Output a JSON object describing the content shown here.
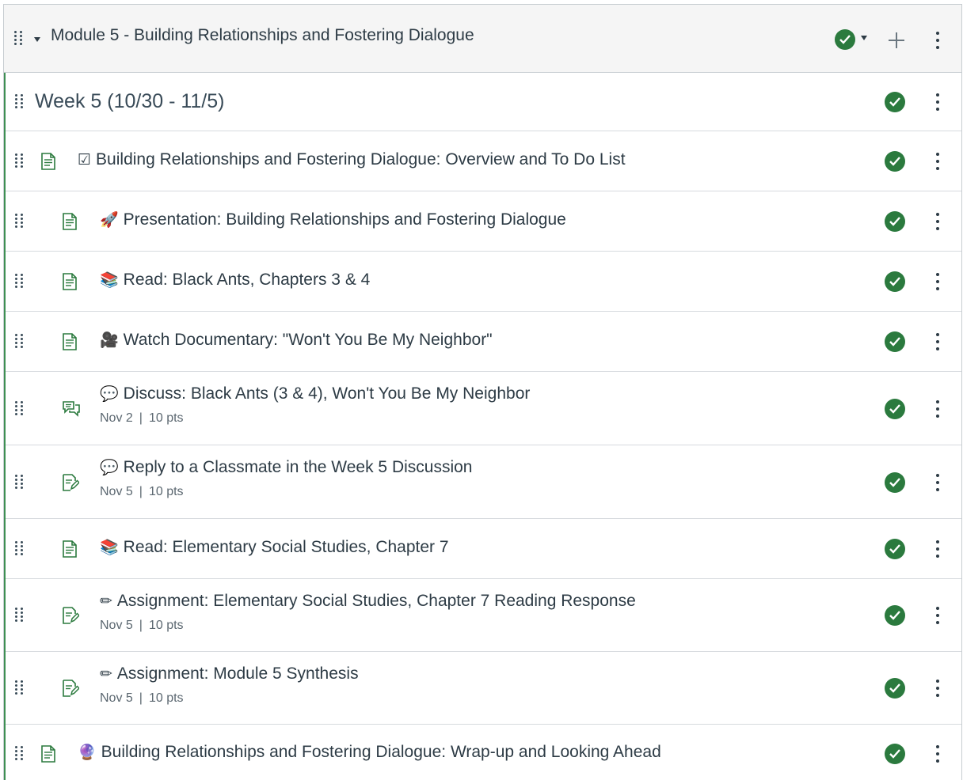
{
  "module": {
    "title": "Module 5 - Building Relationships and Fostering Dialogue",
    "status": "published",
    "accent_color": "#3e8f53",
    "check_color": "#2b7a3e"
  },
  "items": [
    {
      "type": "subheader",
      "title": "Week 5 (10/30 - 11/5)"
    },
    {
      "type": "page",
      "indent": 0,
      "emoji": "☑",
      "title": "Building Relationships and Fostering Dialogue: Overview and To Do List"
    },
    {
      "type": "page",
      "indent": 1,
      "emoji": "🚀",
      "title": "Presentation: Building Relationships and Fostering Dialogue"
    },
    {
      "type": "page",
      "indent": 1,
      "emoji": "📚",
      "title": "Read: Black Ants, Chapters 3 & 4"
    },
    {
      "type": "page",
      "indent": 1,
      "emoji": "🎥",
      "title": "Watch Documentary: \"Won't You Be My Neighbor\""
    },
    {
      "type": "discussion",
      "indent": 1,
      "emoji": "💬",
      "title": "Discuss: Black Ants (3 & 4), Won't You Be My Neighbor",
      "due": "Nov 2",
      "points": "10 pts"
    },
    {
      "type": "assignment",
      "indent": 1,
      "emoji": "💬",
      "title": "Reply to a Classmate in the Week 5 Discussion",
      "due": "Nov 5",
      "points": "10 pts"
    },
    {
      "type": "page",
      "indent": 1,
      "emoji": "📚",
      "title": "Read: Elementary Social Studies, Chapter 7"
    },
    {
      "type": "assignment",
      "indent": 1,
      "emoji": "✏",
      "title": "Assignment: Elementary Social Studies, Chapter 7 Reading Response",
      "due": "Nov 5",
      "points": "10 pts"
    },
    {
      "type": "assignment",
      "indent": 1,
      "emoji": "✏",
      "title": "Assignment: Module 5 Synthesis",
      "due": "Nov 5",
      "points": "10 pts"
    },
    {
      "type": "page",
      "indent": 0,
      "emoji": "🔮",
      "title": "Building Relationships and Fostering Dialogue: Wrap-up and Looking Ahead"
    }
  ]
}
